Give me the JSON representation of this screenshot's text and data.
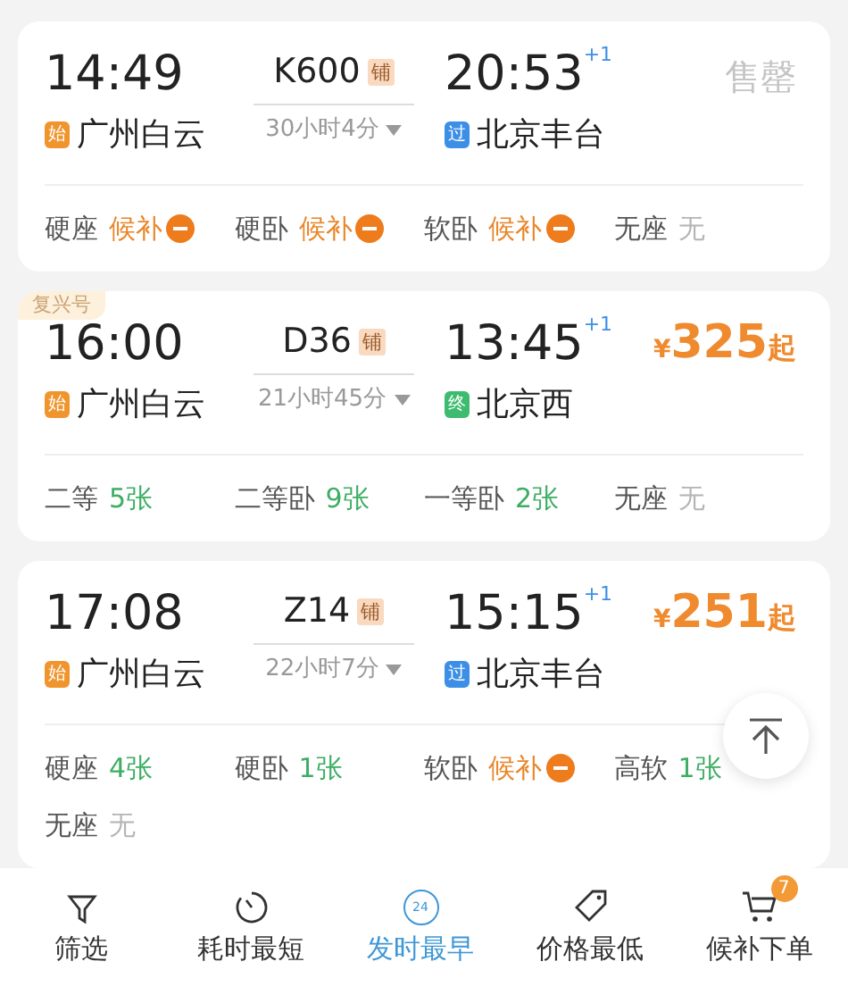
{
  "trains": [
    {
      "depart": "14:49",
      "number": "K600",
      "sleeper_badge": "铺",
      "duration": "30小时4分",
      "arrive": "20:53",
      "day_offset": "+1",
      "from_badge": {
        "text": "始",
        "color": "#f0952e"
      },
      "from": "广州白云",
      "to_badge": {
        "text": "过",
        "color": "#3d8fe6"
      },
      "to": "北京丰台",
      "price": {
        "kind": "soldout",
        "text": "售罄"
      },
      "seats": [
        {
          "name": "硬座",
          "status": "候补",
          "kind": "waitlist"
        },
        {
          "name": "硬卧",
          "status": "候补",
          "kind": "waitlist"
        },
        {
          "name": "软卧",
          "status": "候补",
          "kind": "waitlist"
        },
        {
          "name": "无座",
          "status": "无",
          "kind": "none"
        }
      ]
    },
    {
      "tag": "复兴号",
      "depart": "16:00",
      "number": "D36",
      "sleeper_badge": "铺",
      "duration": "21小时45分",
      "arrive": "13:45",
      "day_offset": "+1",
      "from_badge": {
        "text": "始",
        "color": "#f0952e"
      },
      "from": "广州白云",
      "to_badge": {
        "text": "终",
        "color": "#3dbb6f"
      },
      "to": "北京西",
      "price": {
        "kind": "price",
        "currency": "¥",
        "amount": "325",
        "suffix": "起"
      },
      "seats": [
        {
          "name": "二等",
          "status": "5张",
          "kind": "available"
        },
        {
          "name": "二等卧",
          "status": "9张",
          "kind": "available"
        },
        {
          "name": "一等卧",
          "status": "2张",
          "kind": "available"
        },
        {
          "name": "无座",
          "status": "无",
          "kind": "none"
        }
      ]
    },
    {
      "depart": "17:08",
      "number": "Z14",
      "sleeper_badge": "铺",
      "duration": "22小时7分",
      "arrive": "15:15",
      "day_offset": "+1",
      "from_badge": {
        "text": "始",
        "color": "#f0952e"
      },
      "from": "广州白云",
      "to_badge": {
        "text": "过",
        "color": "#3d8fe6"
      },
      "to": "北京丰台",
      "price": {
        "kind": "price",
        "currency": "¥",
        "amount": "251",
        "suffix": "起"
      },
      "seats": [
        {
          "name": "硬座",
          "status": "4张",
          "kind": "available"
        },
        {
          "name": "硬卧",
          "status": "1张",
          "kind": "available"
        },
        {
          "name": "软卧",
          "status": "候补",
          "kind": "waitlist"
        },
        {
          "name": "高软",
          "status": "1张",
          "kind": "available"
        },
        {
          "name": "无座",
          "status": "无",
          "kind": "none"
        }
      ]
    }
  ],
  "bottom_bar": [
    {
      "label": "筛选",
      "kind": "filter",
      "selected": false
    },
    {
      "label": "耗时最短",
      "kind": "timer",
      "selected": false
    },
    {
      "label": "发时最早",
      "kind": "clock24",
      "icon_text": "24",
      "selected": true
    },
    {
      "label": "价格最低",
      "kind": "tag",
      "selected": false
    },
    {
      "label": "候补下单",
      "kind": "cart",
      "badge": "7",
      "selected": false
    }
  ]
}
